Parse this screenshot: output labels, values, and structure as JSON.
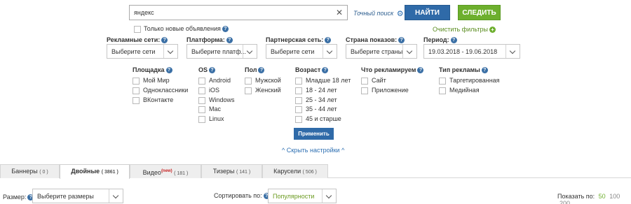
{
  "search": {
    "value": "яндекс",
    "clear_icon": "close-icon",
    "exact_label": "Точный поиск",
    "find_label": "НАЙТИ",
    "follow_label": "СЛЕДИТЬ"
  },
  "only_new_label": "Только новые объявления",
  "clear_filters_label": "Очистить фильтры",
  "selects": [
    {
      "label": "Рекламные сети:",
      "value": "Выберите сети"
    },
    {
      "label": "Платформа:",
      "value": "Выберите платф..."
    },
    {
      "label": "Партнерская сеть:",
      "value": "Выберите сети"
    },
    {
      "label": "Страна показов:",
      "value": "Выберите страны"
    },
    {
      "label": "Период:",
      "value": "19.03.2018 - 19.06.2018"
    }
  ],
  "groups": [
    {
      "title": "Площадка",
      "options": [
        "Мой Мир",
        "Одноклассники",
        "ВКонтакте"
      ]
    },
    {
      "title": "OS",
      "options": [
        "Android",
        "iOS",
        "Windows",
        "Mac",
        "Linux"
      ]
    },
    {
      "title": "Пол",
      "options": [
        "Мужской",
        "Женский"
      ]
    },
    {
      "title": "Возраст",
      "options": [
        "Младше 18 лет",
        "18 - 24 лет",
        "25 - 34 лет",
        "35 - 44 лет",
        "45 и старше"
      ]
    },
    {
      "title": "Что рекламируем",
      "options": [
        "Сайт",
        "Приложение"
      ]
    },
    {
      "title": "Тип рекламы",
      "options": [
        "Таргетированная",
        "Медийная"
      ]
    }
  ],
  "apply_label": "Применить",
  "hide_settings_label": "Скрыть настройки",
  "tabs": [
    {
      "title": "Баннеры",
      "count": "( 0 )",
      "new": ""
    },
    {
      "title": "Двойные",
      "count": "( 3861 )",
      "new": ""
    },
    {
      "title": "Видео",
      "count": "( 181 )",
      "new": "(new)"
    },
    {
      "title": "Тизеры",
      "count": "( 141 )",
      "new": ""
    },
    {
      "title": "Карусели",
      "count": "( 506 )",
      "new": ""
    }
  ],
  "active_tab": "Двойные",
  "bottom": {
    "size_label": "Размер:",
    "size_value": "Выберите размеры",
    "sort_label": "Сортировать по:",
    "sort_value": "Популярности",
    "show_label": "Показать по:",
    "show_options": [
      "50",
      "100",
      "200"
    ],
    "show_current": "50"
  },
  "colors": {
    "primary": "#2f6aa8",
    "green": "#6daf2d",
    "link": "#2d6fb2",
    "sort_value_color": "#6a9a1f"
  }
}
